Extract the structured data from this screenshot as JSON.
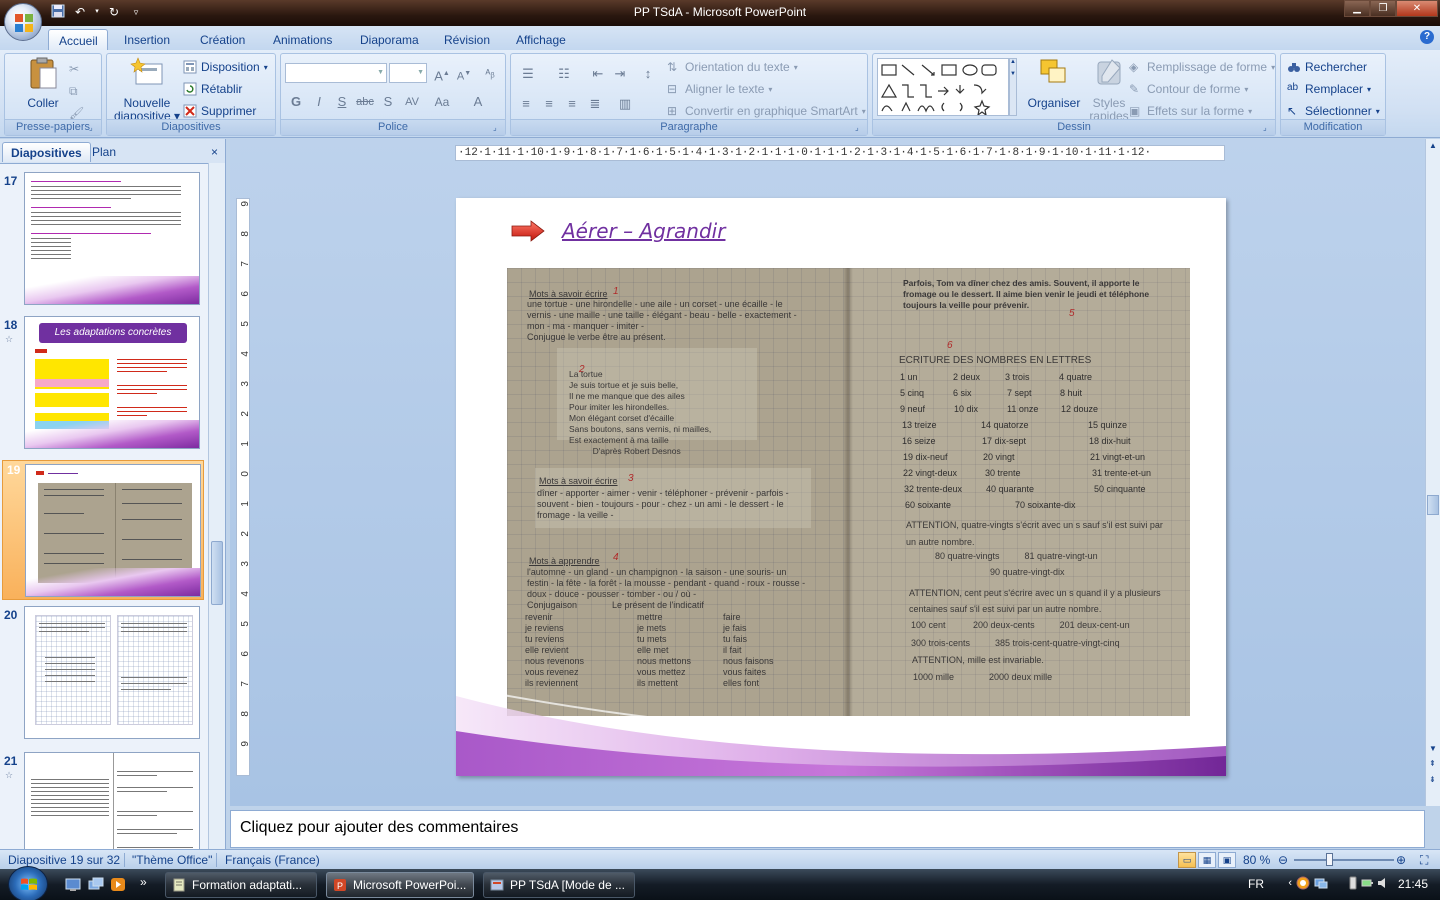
{
  "window": {
    "title": "PP TSdA - Microsoft PowerPoint"
  },
  "ribbon_tabs": [
    {
      "label": "Accueil",
      "active": true
    },
    {
      "label": "Insertion"
    },
    {
      "label": "Création"
    },
    {
      "label": "Animations"
    },
    {
      "label": "Diaporama"
    },
    {
      "label": "Révision"
    },
    {
      "label": "Affichage"
    }
  ],
  "groups": {
    "clipboard": {
      "label": "Presse-papiers",
      "paste": "Coller"
    },
    "slides": {
      "label": "Diapositives",
      "new_slide_line1": "Nouvelle",
      "new_slide_line2": "diapositive",
      "layout": "Disposition",
      "reset": "Rétablir",
      "delete": "Supprimer"
    },
    "font": {
      "label": "Police"
    },
    "paragraph": {
      "label": "Paragraphe",
      "text_direction": "Orientation du texte",
      "align_text": "Aligner le texte",
      "smartart": "Convertir en graphique SmartArt"
    },
    "drawing": {
      "label": "Dessin",
      "arrange": "Organiser",
      "styles_line1": "Styles",
      "styles_line2": "rapides",
      "fill": "Remplissage de forme",
      "outline": "Contour de forme",
      "effects": "Effets sur la forme"
    },
    "editing": {
      "label": "Modification",
      "find": "Rechercher",
      "replace": "Remplacer",
      "select": "Sélectionner"
    }
  },
  "left_panel": {
    "tab_slides": "Diapositives",
    "tab_outline": "Plan",
    "close": "×",
    "slides": [
      {
        "num": "17"
      },
      {
        "num": "18",
        "title": "Les adaptations concrètes"
      },
      {
        "num": "19",
        "selected": true
      },
      {
        "num": "20"
      },
      {
        "num": "21"
      }
    ]
  },
  "ruler": {
    "horizontal": "·12·1·11·1·10·1·9·1·8·1·7·1·6·1·5·1·4·1·3·1·2·1·1·1·0·1·1·1·2·1·3·1·4·1·5·1·6·1·7·1·8·1·9·1·10·1·11·1·12·",
    "vertical": [
      "9",
      "8",
      "7",
      "6",
      "5",
      "4",
      "3",
      "2",
      "1",
      "0",
      "1",
      "2",
      "3",
      "4",
      "5",
      "6",
      "7",
      "8",
      "9"
    ]
  },
  "slide": {
    "title": "Aérer – Agrandir",
    "photo": {
      "left_heading1": "Mots à savoir écrire",
      "left_mark1": "1",
      "left_text1": "une tortue - une hirondelle - une aile - un corset - une écaille - le\nvernis - une maille - une taille - élégant - beau - belle - exactement -\nmon - ma - manquer - imiter -\nConjugue le verbe être au présent.",
      "left_mark2": "2",
      "poem": "La tortue\nJe suis tortue et je suis belle,\nIl ne me manque que des ailes\nPour imiter les hirondelles.\nMon élégant corset d'écaille\nSans boutons, sans vernis, ni mailles,\nEst exactement à ma taille\n          D'après Robert Desnos",
      "left_heading2": "Mots à savoir écrire",
      "left_mark3": "3",
      "left_text2": "dîner - apporter - aimer - venir - téléphoner - prévenir - parfois -\nsouvent - bien - toujours - pour - chez - un ami - le dessert - le\nfromage - la veille -",
      "left_heading3": "Mots à apprendre",
      "left_mark4": "4",
      "left_text3": "l'automne - un gland - un champignon - la saison - une souris- un\nfestin - la fête - la forêt - la mousse - pendant - quand - roux - rousse -\ndoux - douce - pousser - tomber - ou / où -",
      "conj_title": "Conjugaison              Le présent de l'indicatif",
      "conj_col1": "revenir\nje reviens\ntu reviens\nelle revient\nnous revenons\nvous revenez\nils reviennent",
      "conj_col2": "mettre\nje mets\ntu mets\nelle met\nnous mettons\nvous mettez\nils mettent",
      "conj_col3": "faire\nje fais\ntu fais\nil fait\nnous faisons\nvous faites\nelles font",
      "right_text1": "Parfois, Tom va dîner chez des amis. Souvent, il apporte le\nfromage ou le dessert. Il aime bien venir le jeudi et téléphone\ntoujours la veille pour prévenir.",
      "right_mark5": "5",
      "right_mark6": "6",
      "right_heading": "ECRITURE DES NOMBRES EN LETTRES",
      "numbers": [
        [
          "1 un",
          "2 deux",
          "3 trois",
          "4 quatre"
        ],
        [
          "5 cinq",
          "6 six",
          "7 sept",
          "8 huit"
        ],
        [
          "9 neuf",
          "10 dix",
          "11 onze",
          "12 douze"
        ],
        [
          "13 treize",
          "14 quatorze",
          "15 quinze"
        ],
        [
          "16 seize",
          "17 dix-sept",
          "18 dix-huit"
        ],
        [
          "19 dix-neuf",
          "20 vingt",
          "21 vingt-et-un"
        ],
        [
          "22 vingt-deux",
          "30 trente",
          "31 trente-et-un"
        ],
        [
          "32 trente-deux",
          "40 quarante",
          "50 cinquante"
        ],
        [
          "60 soixante",
          "70 soixante-dix"
        ]
      ],
      "attention1": "ATTENTION, quatre-vingts s'écrit avec un s sauf s'il est suivi par\nun autre nombre.",
      "line80": "80 quatre-vingts          81 quatre-vingt-un",
      "line90": "90 quatre-vingt-dix",
      "attention2": "ATTENTION, cent peut s'écrire avec un s quand il y a plusieurs\ncentaines sauf s'il est suivi par un autre nombre.",
      "line100": "100 cent           200 deux-cents          201 deux-cent-un",
      "line300": "300 trois-cents          385 trois-cent-quatre-vingt-cinq",
      "attention3": "ATTENTION, mille est invariable.",
      "line1000": "1000 mille              2000 deux mille"
    }
  },
  "notes": {
    "placeholder": "Cliquez pour ajouter des commentaires"
  },
  "statusbar": {
    "slide_info": "Diapositive 19 sur 32",
    "theme": "\"Thème Office\"",
    "language": "Français (France)",
    "zoom": "80 %"
  },
  "taskbar": {
    "items": [
      {
        "label": "Formation adaptati..."
      },
      {
        "label": "Microsoft PowerPoi...",
        "active": true
      },
      {
        "label": "PP TSdA [Mode de ..."
      }
    ],
    "lang": "FR",
    "time": "21:45"
  },
  "colors": {
    "accent_purple": "#7030a0",
    "title_bar": "#2a170f",
    "ribbon_text": "#15428b"
  }
}
